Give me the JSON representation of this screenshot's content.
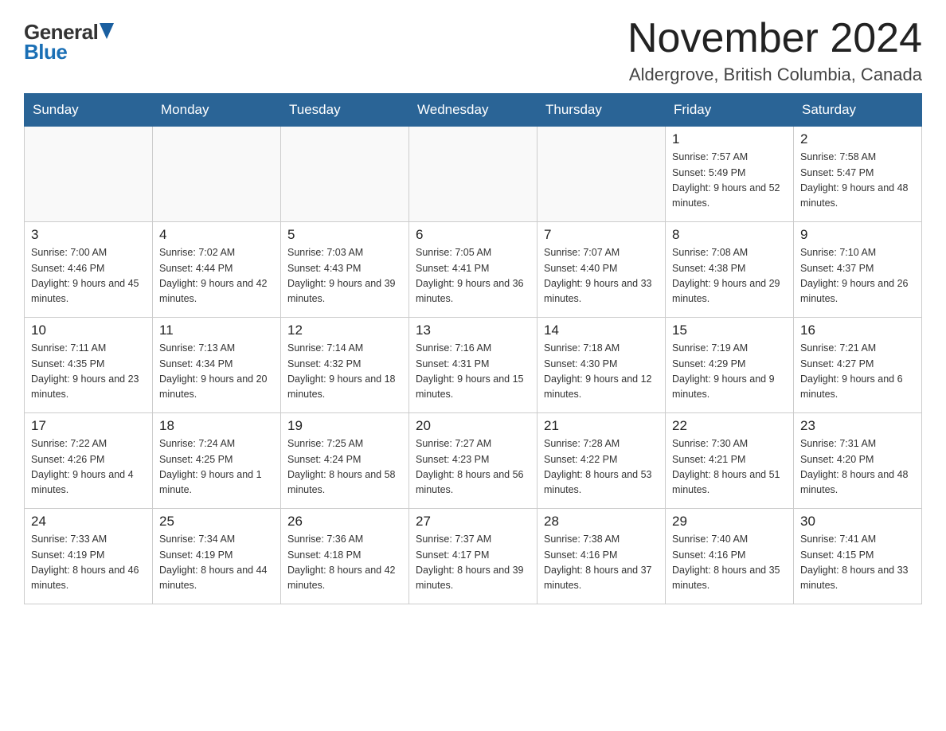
{
  "logo": {
    "general": "General",
    "blue": "Blue"
  },
  "title": {
    "month_year": "November 2024",
    "location": "Aldergrove, British Columbia, Canada"
  },
  "weekdays": [
    "Sunday",
    "Monday",
    "Tuesday",
    "Wednesday",
    "Thursday",
    "Friday",
    "Saturday"
  ],
  "weeks": [
    [
      {
        "day": "",
        "sunrise": "",
        "sunset": "",
        "daylight": ""
      },
      {
        "day": "",
        "sunrise": "",
        "sunset": "",
        "daylight": ""
      },
      {
        "day": "",
        "sunrise": "",
        "sunset": "",
        "daylight": ""
      },
      {
        "day": "",
        "sunrise": "",
        "sunset": "",
        "daylight": ""
      },
      {
        "day": "",
        "sunrise": "",
        "sunset": "",
        "daylight": ""
      },
      {
        "day": "1",
        "sunrise": "Sunrise: 7:57 AM",
        "sunset": "Sunset: 5:49 PM",
        "daylight": "Daylight: 9 hours and 52 minutes."
      },
      {
        "day": "2",
        "sunrise": "Sunrise: 7:58 AM",
        "sunset": "Sunset: 5:47 PM",
        "daylight": "Daylight: 9 hours and 48 minutes."
      }
    ],
    [
      {
        "day": "3",
        "sunrise": "Sunrise: 7:00 AM",
        "sunset": "Sunset: 4:46 PM",
        "daylight": "Daylight: 9 hours and 45 minutes."
      },
      {
        "day": "4",
        "sunrise": "Sunrise: 7:02 AM",
        "sunset": "Sunset: 4:44 PM",
        "daylight": "Daylight: 9 hours and 42 minutes."
      },
      {
        "day": "5",
        "sunrise": "Sunrise: 7:03 AM",
        "sunset": "Sunset: 4:43 PM",
        "daylight": "Daylight: 9 hours and 39 minutes."
      },
      {
        "day": "6",
        "sunrise": "Sunrise: 7:05 AM",
        "sunset": "Sunset: 4:41 PM",
        "daylight": "Daylight: 9 hours and 36 minutes."
      },
      {
        "day": "7",
        "sunrise": "Sunrise: 7:07 AM",
        "sunset": "Sunset: 4:40 PM",
        "daylight": "Daylight: 9 hours and 33 minutes."
      },
      {
        "day": "8",
        "sunrise": "Sunrise: 7:08 AM",
        "sunset": "Sunset: 4:38 PM",
        "daylight": "Daylight: 9 hours and 29 minutes."
      },
      {
        "day": "9",
        "sunrise": "Sunrise: 7:10 AM",
        "sunset": "Sunset: 4:37 PM",
        "daylight": "Daylight: 9 hours and 26 minutes."
      }
    ],
    [
      {
        "day": "10",
        "sunrise": "Sunrise: 7:11 AM",
        "sunset": "Sunset: 4:35 PM",
        "daylight": "Daylight: 9 hours and 23 minutes."
      },
      {
        "day": "11",
        "sunrise": "Sunrise: 7:13 AM",
        "sunset": "Sunset: 4:34 PM",
        "daylight": "Daylight: 9 hours and 20 minutes."
      },
      {
        "day": "12",
        "sunrise": "Sunrise: 7:14 AM",
        "sunset": "Sunset: 4:32 PM",
        "daylight": "Daylight: 9 hours and 18 minutes."
      },
      {
        "day": "13",
        "sunrise": "Sunrise: 7:16 AM",
        "sunset": "Sunset: 4:31 PM",
        "daylight": "Daylight: 9 hours and 15 minutes."
      },
      {
        "day": "14",
        "sunrise": "Sunrise: 7:18 AM",
        "sunset": "Sunset: 4:30 PM",
        "daylight": "Daylight: 9 hours and 12 minutes."
      },
      {
        "day": "15",
        "sunrise": "Sunrise: 7:19 AM",
        "sunset": "Sunset: 4:29 PM",
        "daylight": "Daylight: 9 hours and 9 minutes."
      },
      {
        "day": "16",
        "sunrise": "Sunrise: 7:21 AM",
        "sunset": "Sunset: 4:27 PM",
        "daylight": "Daylight: 9 hours and 6 minutes."
      }
    ],
    [
      {
        "day": "17",
        "sunrise": "Sunrise: 7:22 AM",
        "sunset": "Sunset: 4:26 PM",
        "daylight": "Daylight: 9 hours and 4 minutes."
      },
      {
        "day": "18",
        "sunrise": "Sunrise: 7:24 AM",
        "sunset": "Sunset: 4:25 PM",
        "daylight": "Daylight: 9 hours and 1 minute."
      },
      {
        "day": "19",
        "sunrise": "Sunrise: 7:25 AM",
        "sunset": "Sunset: 4:24 PM",
        "daylight": "Daylight: 8 hours and 58 minutes."
      },
      {
        "day": "20",
        "sunrise": "Sunrise: 7:27 AM",
        "sunset": "Sunset: 4:23 PM",
        "daylight": "Daylight: 8 hours and 56 minutes."
      },
      {
        "day": "21",
        "sunrise": "Sunrise: 7:28 AM",
        "sunset": "Sunset: 4:22 PM",
        "daylight": "Daylight: 8 hours and 53 minutes."
      },
      {
        "day": "22",
        "sunrise": "Sunrise: 7:30 AM",
        "sunset": "Sunset: 4:21 PM",
        "daylight": "Daylight: 8 hours and 51 minutes."
      },
      {
        "day": "23",
        "sunrise": "Sunrise: 7:31 AM",
        "sunset": "Sunset: 4:20 PM",
        "daylight": "Daylight: 8 hours and 48 minutes."
      }
    ],
    [
      {
        "day": "24",
        "sunrise": "Sunrise: 7:33 AM",
        "sunset": "Sunset: 4:19 PM",
        "daylight": "Daylight: 8 hours and 46 minutes."
      },
      {
        "day": "25",
        "sunrise": "Sunrise: 7:34 AM",
        "sunset": "Sunset: 4:19 PM",
        "daylight": "Daylight: 8 hours and 44 minutes."
      },
      {
        "day": "26",
        "sunrise": "Sunrise: 7:36 AM",
        "sunset": "Sunset: 4:18 PM",
        "daylight": "Daylight: 8 hours and 42 minutes."
      },
      {
        "day": "27",
        "sunrise": "Sunrise: 7:37 AM",
        "sunset": "Sunset: 4:17 PM",
        "daylight": "Daylight: 8 hours and 39 minutes."
      },
      {
        "day": "28",
        "sunrise": "Sunrise: 7:38 AM",
        "sunset": "Sunset: 4:16 PM",
        "daylight": "Daylight: 8 hours and 37 minutes."
      },
      {
        "day": "29",
        "sunrise": "Sunrise: 7:40 AM",
        "sunset": "Sunset: 4:16 PM",
        "daylight": "Daylight: 8 hours and 35 minutes."
      },
      {
        "day": "30",
        "sunrise": "Sunrise: 7:41 AM",
        "sunset": "Sunset: 4:15 PM",
        "daylight": "Daylight: 8 hours and 33 minutes."
      }
    ]
  ]
}
